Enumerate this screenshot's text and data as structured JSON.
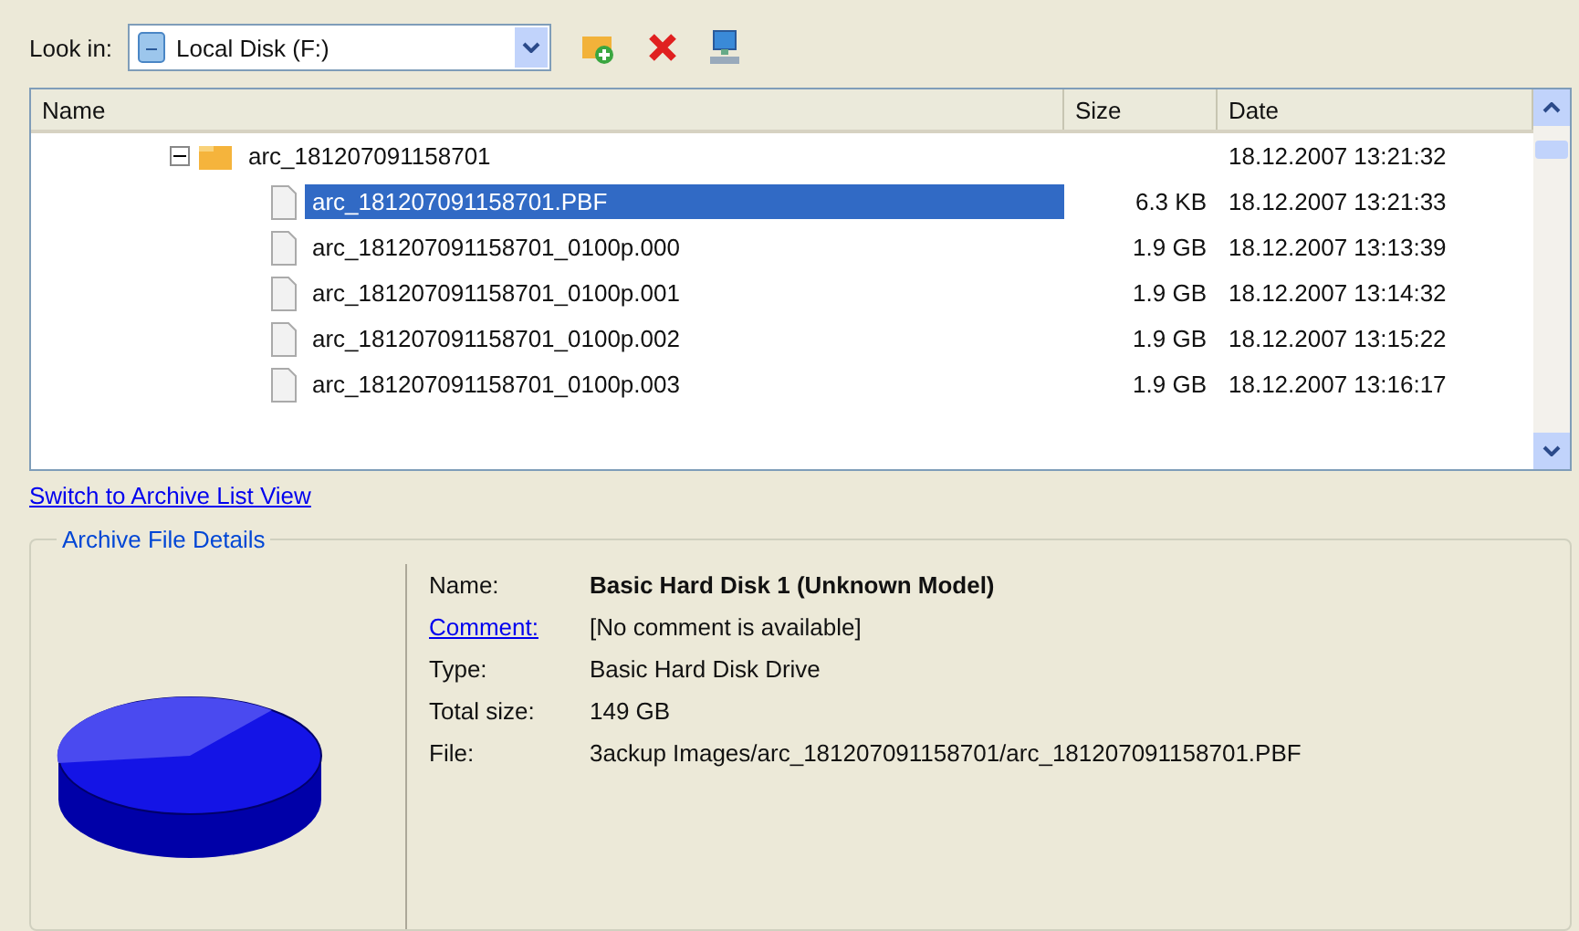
{
  "look_in": {
    "label": "Look in:",
    "value": "Local Disk (F:)"
  },
  "file_list": {
    "columns": [
      "Name",
      "Size",
      "Date"
    ],
    "tree": [
      {
        "kind": "folder",
        "name": "arc_181207091158701",
        "date": "18.12.2007 13:21:32",
        "expanded": true,
        "selected": false,
        "children": [
          {
            "kind": "file",
            "name": "arc_181207091158701.PBF",
            "size": "6.3 KB",
            "date": "18.12.2007 13:21:33",
            "selected": true
          },
          {
            "kind": "file",
            "name": "arc_181207091158701_0100p.000",
            "size": "1.9 GB",
            "date": "18.12.2007 13:13:39",
            "selected": false
          },
          {
            "kind": "file",
            "name": "arc_181207091158701_0100p.001",
            "size": "1.9 GB",
            "date": "18.12.2007 13:14:32",
            "selected": false
          },
          {
            "kind": "file",
            "name": "arc_181207091158701_0100p.002",
            "size": "1.9 GB",
            "date": "18.12.2007 13:15:22",
            "selected": false
          },
          {
            "kind": "file",
            "name": "arc_181207091158701_0100p.003",
            "size": "1.9 GB",
            "date": "18.12.2007 13:16:17",
            "selected": false
          }
        ]
      }
    ]
  },
  "switch_link": "Switch to Archive List View",
  "details": {
    "title": "Archive File Details",
    "fields": [
      {
        "kind": "bold",
        "label": "Name:",
        "value": "Basic Hard Disk 1 (Unknown Model)"
      },
      {
        "kind": "link",
        "label": "Comment:",
        "value": "[No comment is available]"
      },
      {
        "kind": "plain",
        "label": "Type:",
        "value": "Basic Hard Disk Drive"
      },
      {
        "kind": "plain",
        "label": "Total size:",
        "value": "149 GB"
      },
      {
        "kind": "plain",
        "label": "File:",
        "value": "3ackup Images/arc_181207091158701/arc_181207091158701.PBF"
      }
    ]
  }
}
